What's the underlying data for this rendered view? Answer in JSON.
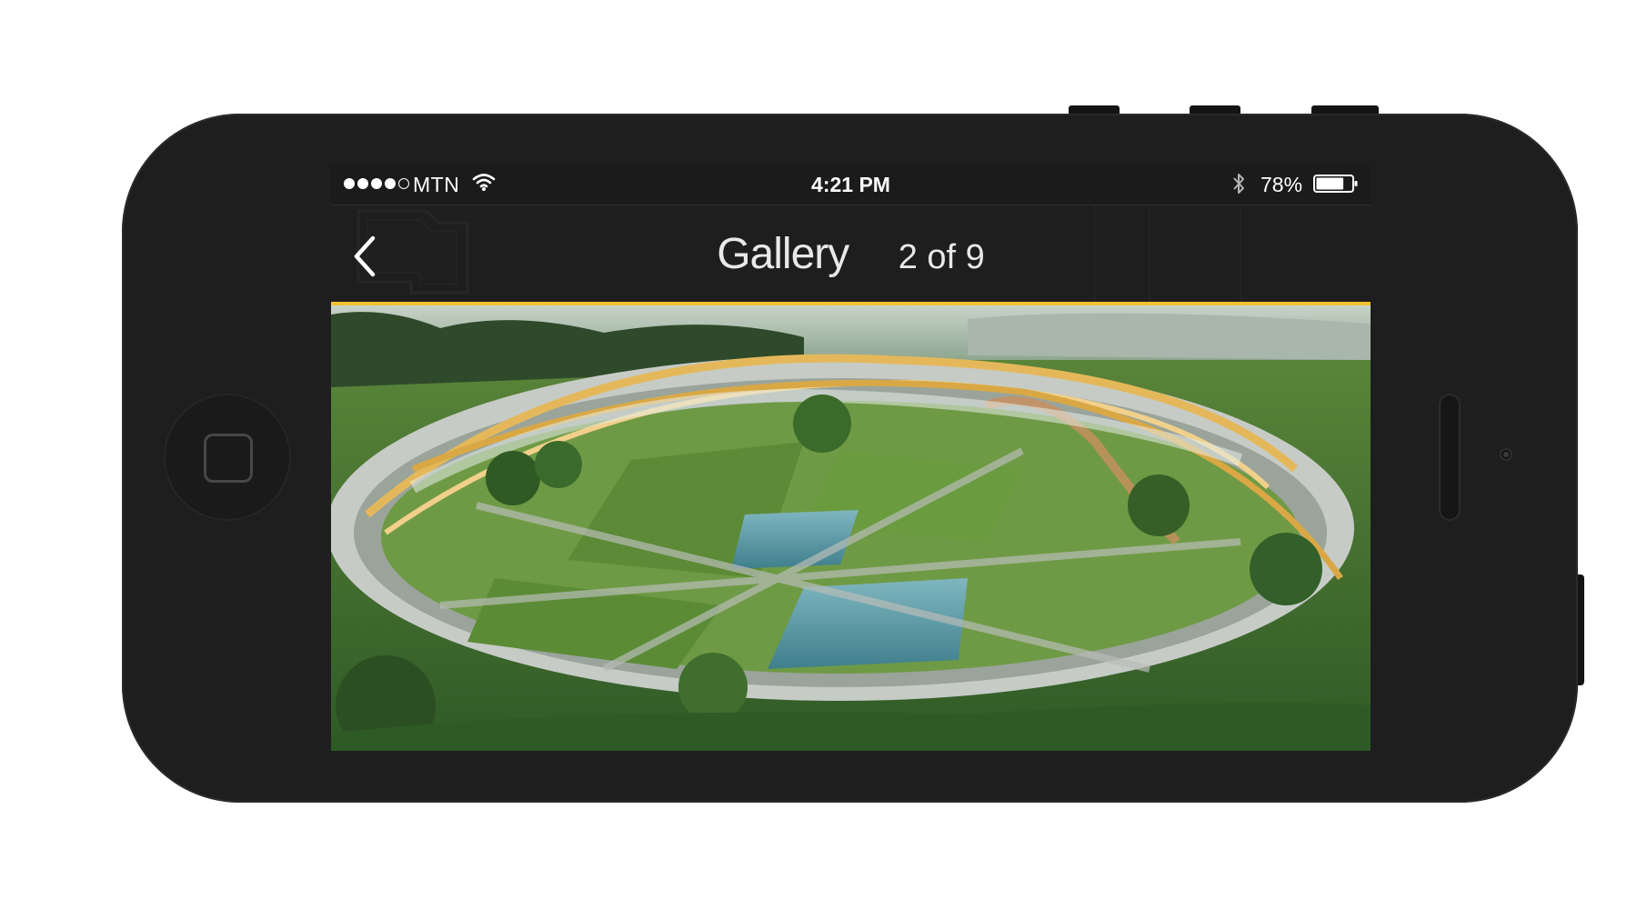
{
  "status_bar": {
    "signal_strength": "4 of 5",
    "carrier": "MTN",
    "time": "4:21 PM",
    "battery_percent": "78%",
    "battery_level": 0.78
  },
  "nav": {
    "title": "Gallery",
    "counter": "2 of 9"
  },
  "icons": {
    "back": "chevron-left-icon",
    "wifi": "wifi-icon",
    "bluetooth": "bluetooth-icon",
    "battery": "battery-icon"
  },
  "colors": {
    "accent": "#f2c12e",
    "phone_body": "#1e1e1e",
    "status_bar_bg": "#1b1b1b"
  }
}
